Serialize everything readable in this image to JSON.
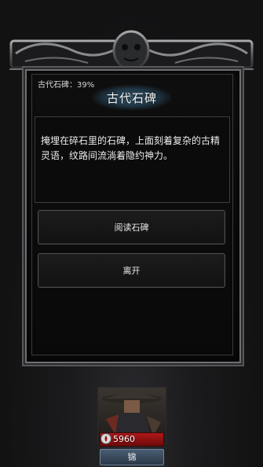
{
  "event": {
    "progress_label": "古代石碑：39%",
    "title": "古代石碑",
    "description": "掩埋在碎石里的石碑，上面刻着复杂的古精灵语，纹路间流淌着隐约神力。"
  },
  "choices": [
    {
      "label": "阅读石碑"
    },
    {
      "label": "离开"
    }
  ],
  "character": {
    "hp": "5960",
    "name": "锦"
  },
  "colors": {
    "hp_bar": "#b01818",
    "name_plate": "#3b4d62",
    "frame_metal": "#6f6f72"
  }
}
